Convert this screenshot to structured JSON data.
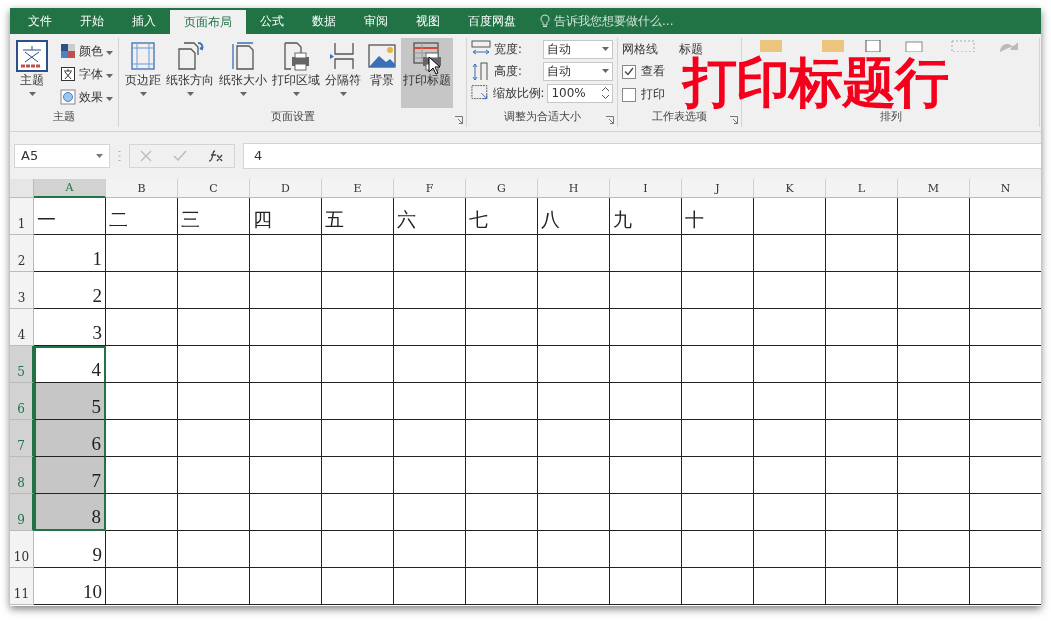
{
  "tabs": [
    {
      "label": "文件",
      "selected": false
    },
    {
      "label": "开始",
      "selected": false
    },
    {
      "label": "插入",
      "selected": false
    },
    {
      "label": "页面布局",
      "selected": true
    },
    {
      "label": "公式",
      "selected": false
    },
    {
      "label": "数据",
      "selected": false
    },
    {
      "label": "审阅",
      "selected": false
    },
    {
      "label": "视图",
      "selected": false
    },
    {
      "label": "百度网盘",
      "selected": false
    }
  ],
  "tell_me": {
    "placeholder": "告诉我您想要做什么..."
  },
  "ribbon": {
    "theme_group": {
      "label": "主题",
      "big": {
        "label": "主题"
      },
      "small": [
        {
          "label": "颜色",
          "kind": "colors"
        },
        {
          "label": "字体",
          "kind": "fonts"
        },
        {
          "label": "效果",
          "kind": "effects"
        }
      ]
    },
    "page_setup_group": {
      "label": "页面设置",
      "buttons": [
        {
          "label": "页边距",
          "kind": "margins",
          "dropdown": true,
          "hovered": false
        },
        {
          "label": "纸张方向",
          "kind": "orientation",
          "dropdown": true,
          "hovered": false
        },
        {
          "label": "纸张大小",
          "kind": "size",
          "dropdown": true,
          "hovered": false
        },
        {
          "label": "打印区域",
          "kind": "print-area",
          "dropdown": true,
          "hovered": false
        },
        {
          "label": "分隔符",
          "kind": "breaks",
          "dropdown": true,
          "hovered": false
        },
        {
          "label": "背景",
          "kind": "background",
          "dropdown": false,
          "hovered": false
        },
        {
          "label": "打印标题",
          "kind": "print-titles",
          "dropdown": false,
          "hovered": true
        }
      ]
    },
    "scale_group": {
      "label": "调整为合适大小",
      "fields": [
        {
          "label": "宽度:",
          "value": "自动",
          "kind": "width"
        },
        {
          "label": "高度:",
          "value": "自动",
          "kind": "height"
        },
        {
          "label": "缩放比例:",
          "value": "100%",
          "kind": "scale"
        }
      ]
    },
    "sheet_options_group": {
      "label": "工作表选项",
      "sections": [
        {
          "title": "网格线",
          "options": [
            {
              "label": "查看",
              "checked": true
            },
            {
              "label": "打印",
              "checked": false
            }
          ]
        },
        {
          "title": "标题"
        }
      ]
    },
    "arrange_group": {
      "label": "排列"
    }
  },
  "formula_bar": {
    "name_box": "A5",
    "value": "4"
  },
  "columns": [
    {
      "label": "A",
      "selected": true
    },
    {
      "label": "B",
      "selected": false
    },
    {
      "label": "C",
      "selected": false
    },
    {
      "label": "D",
      "selected": false
    },
    {
      "label": "E",
      "selected": false
    },
    {
      "label": "F",
      "selected": false
    },
    {
      "label": "G",
      "selected": false
    },
    {
      "label": "H",
      "selected": false
    },
    {
      "label": "I",
      "selected": false
    },
    {
      "label": "J",
      "selected": false
    },
    {
      "label": "K",
      "selected": false
    },
    {
      "label": "L",
      "selected": false
    },
    {
      "label": "M",
      "selected": false
    },
    {
      "label": "N",
      "selected": false
    }
  ],
  "rows": [
    {
      "header": "1",
      "values": [
        "一",
        "二",
        "三",
        "四",
        "五",
        "六",
        "七",
        "八",
        "九",
        "十"
      ],
      "selected": false,
      "active": false
    },
    {
      "header": "2",
      "values": [
        "1"
      ],
      "selected": false,
      "active": false
    },
    {
      "header": "3",
      "values": [
        "2"
      ],
      "selected": false,
      "active": false
    },
    {
      "header": "4",
      "values": [
        "3"
      ],
      "selected": false,
      "active": false
    },
    {
      "header": "5",
      "values": [
        "4"
      ],
      "selected": true,
      "active": true
    },
    {
      "header": "6",
      "values": [
        "5"
      ],
      "selected": true,
      "active": false
    },
    {
      "header": "7",
      "values": [
        "6"
      ],
      "selected": true,
      "active": false
    },
    {
      "header": "8",
      "values": [
        "7"
      ],
      "selected": true,
      "active": false
    },
    {
      "header": "9",
      "values": [
        "8"
      ],
      "selected": true,
      "active": false
    },
    {
      "header": "10",
      "values": [
        "9"
      ],
      "selected": false,
      "active": false
    },
    {
      "header": "11",
      "values": [
        "10"
      ],
      "selected": false,
      "active": false
    }
  ],
  "caption": "打印标题行"
}
